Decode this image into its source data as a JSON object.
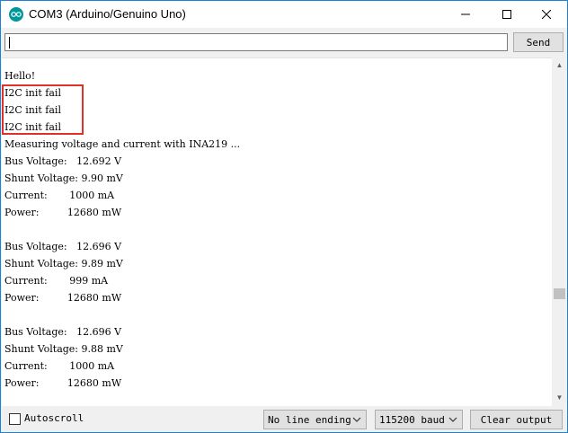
{
  "window": {
    "title": "COM3 (Arduino/Genuino Uno)",
    "icon": "arduino-icon",
    "accent_color": "#00979c",
    "controls": [
      "minimize-icon",
      "maximize-icon",
      "close-icon"
    ]
  },
  "toolbar": {
    "input_value": "",
    "send_label": "Send"
  },
  "output": {
    "lines": [
      "Hello!",
      "I2C init fail",
      "I2C init fail",
      "I2C init fail",
      "Measuring voltage and current with INA219 ...",
      "Bus Voltage:   12.692 V",
      "Shunt Voltage: 9.90 mV",
      "Current:       1000 mA",
      "Power:         12680 mW",
      "",
      "Bus Voltage:   12.696 V",
      "Shunt Voltage: 9.89 mV",
      "Current:       999 mA",
      "Power:         12680 mW",
      "",
      "Bus Voltage:   12.696 V",
      "Shunt Voltage: 9.88 mV",
      "Current:       1000 mA",
      "Power:         12680 mW"
    ],
    "highlight_color": "#e0302a"
  },
  "statusbar": {
    "autoscroll_label": "Autoscroll",
    "autoscroll_checked": false,
    "line_ending_value": "No line ending",
    "baud_value": "115200 baud",
    "clear_label": "Clear output"
  }
}
